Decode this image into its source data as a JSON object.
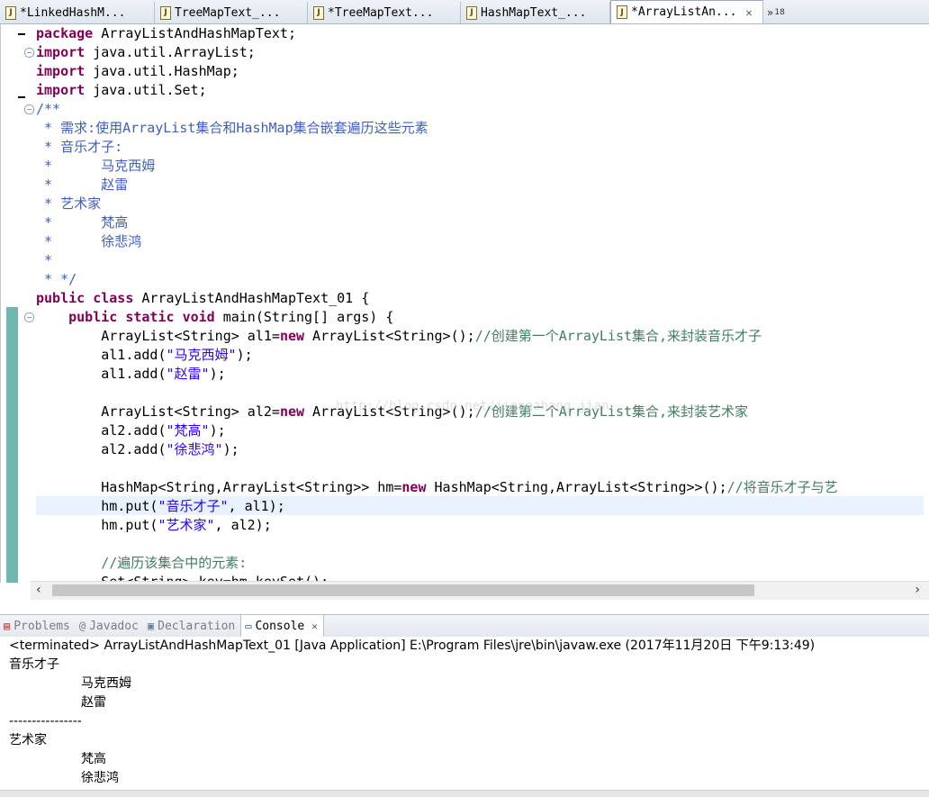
{
  "tabs": [
    {
      "label": "*LinkedHashM...",
      "active": false
    },
    {
      "label": "TreeMapText_...",
      "active": false
    },
    {
      "label": "*TreeMapText...",
      "active": false
    },
    {
      "label": "HashMapText_...",
      "active": false
    },
    {
      "label": "*ArrayListAn...",
      "active": true
    }
  ],
  "tab_overflow": {
    "glyph": "»",
    "count": "18"
  },
  "code": {
    "l1": [
      "package",
      " ArrayListAndHashMapText;"
    ],
    "l2": [
      "import",
      " java.util.ArrayList;"
    ],
    "l3": [
      "import",
      " java.util.HashMap;"
    ],
    "l4": [
      "import",
      " java.util.Set;"
    ],
    "l5": "/**",
    "l6": " * 需求:使用ArrayList集合和HashMap集合嵌套遍历这些元素",
    "l7": " * 音乐才子:",
    "l8": " *      马克西姆",
    "l9": " *      赵雷",
    "l10": " * 艺术家",
    "l11": " *      梵高",
    "l12": " *      徐悲鸿",
    "l13": " *",
    "l14": " * */",
    "l15": [
      "public",
      " ",
      "class",
      " ArrayListAndHashMapText_01 {"
    ],
    "l16": [
      "    ",
      "public",
      " ",
      "static",
      " ",
      "void",
      " main(String[] args) {"
    ],
    "l17": [
      "        ArrayList<String> al1=",
      "new",
      " ArrayList<String>();",
      "//创建第一个ArrayList集合,来封装音乐才子"
    ],
    "l18": [
      "        al1.add(",
      "\"马克西姆\"",
      ");"
    ],
    "l19": [
      "        al1.add(",
      "\"赵雷\"",
      ");"
    ],
    "l20": "",
    "l21": [
      "        ArrayList<String> al2=",
      "new",
      " ArrayList<String>();",
      "//创建第二个ArrayList集合,来封装艺术家"
    ],
    "l22": [
      "        al2.add(",
      "\"梵高\"",
      ");"
    ],
    "l23": [
      "        al2.add(",
      "\"徐悲鸿\"",
      ");"
    ],
    "l24": "",
    "l25": [
      "        HashMap<String,ArrayList<String>> hm=",
      "new",
      " HashMap<String,ArrayList<String>>();",
      "//将音乐才子与艺"
    ],
    "l26": [
      "        hm.put(",
      "\"音乐才子\"",
      ", al1);"
    ],
    "l27": [
      "        hm.put(",
      "\"艺术家\"",
      ", al2);"
    ],
    "l28": "",
    "l29": "        //遍历该集合中的元素:",
    "l30": "        Set<String> key=hm.keySet();"
  },
  "watermark": "http://blog.csdn.net/jiangzhang_jian",
  "views": [
    {
      "label": "Problems",
      "icon": "problems-icon",
      "active": false
    },
    {
      "label": "Javadoc",
      "icon": "javadoc-icon",
      "active": false
    },
    {
      "label": "Declaration",
      "icon": "declaration-icon",
      "active": false
    },
    {
      "label": "Console",
      "icon": "console-icon",
      "active": true
    }
  ],
  "console": {
    "header": "<terminated> ArrayListAndHashMapText_01 [Java Application] E:\\Program Files\\jre\\bin\\javaw.exe (2017年11月20日 下午9:13:49)",
    "lines": [
      "音乐才子",
      "\t马克西姆",
      "\t赵雷",
      "----------------",
      "艺术家",
      "\t梵高",
      "\t徐悲鸿"
    ]
  }
}
